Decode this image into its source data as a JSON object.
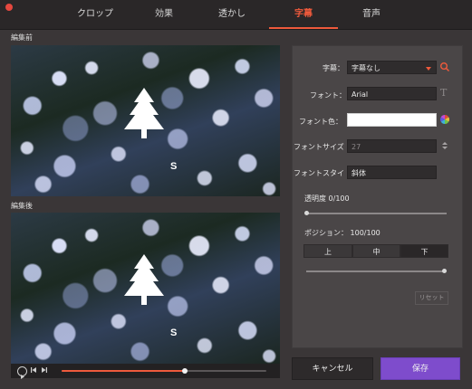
{
  "tabs": [
    {
      "label": "クロップ",
      "active": false
    },
    {
      "label": "効果",
      "active": false
    },
    {
      "label": "透かし",
      "active": false
    },
    {
      "label": "字幕",
      "active": true
    },
    {
      "label": "音声",
      "active": false
    }
  ],
  "preview": {
    "before_label": "編集前",
    "after_label": "編集後",
    "subtitle_text": "S",
    "playback_progress": 0.6
  },
  "settings": {
    "subtitle_label": "字幕：",
    "subtitle_value": "字幕なし",
    "font_label": "フォント：",
    "font_value": "Arial",
    "font_color_label": "フォント色：",
    "font_color_value": "#ffffff",
    "font_size_label": "フォントサイズ",
    "font_size_value": "27",
    "font_style_label": "フォントスタイ",
    "font_style_value": "斜体",
    "opacity_label": "透明度 0/100",
    "opacity_value": 0,
    "position_label": "ポジション： 100/100",
    "position_value": 100,
    "position_options": [
      "上",
      "中",
      "下"
    ],
    "position_selected": "下",
    "reset_label": "リセット"
  },
  "buttons": {
    "cancel_label": "キャンセル",
    "save_label": "保存"
  },
  "colors": {
    "accent": "#ef5a3c",
    "save": "#7e4ccc"
  }
}
